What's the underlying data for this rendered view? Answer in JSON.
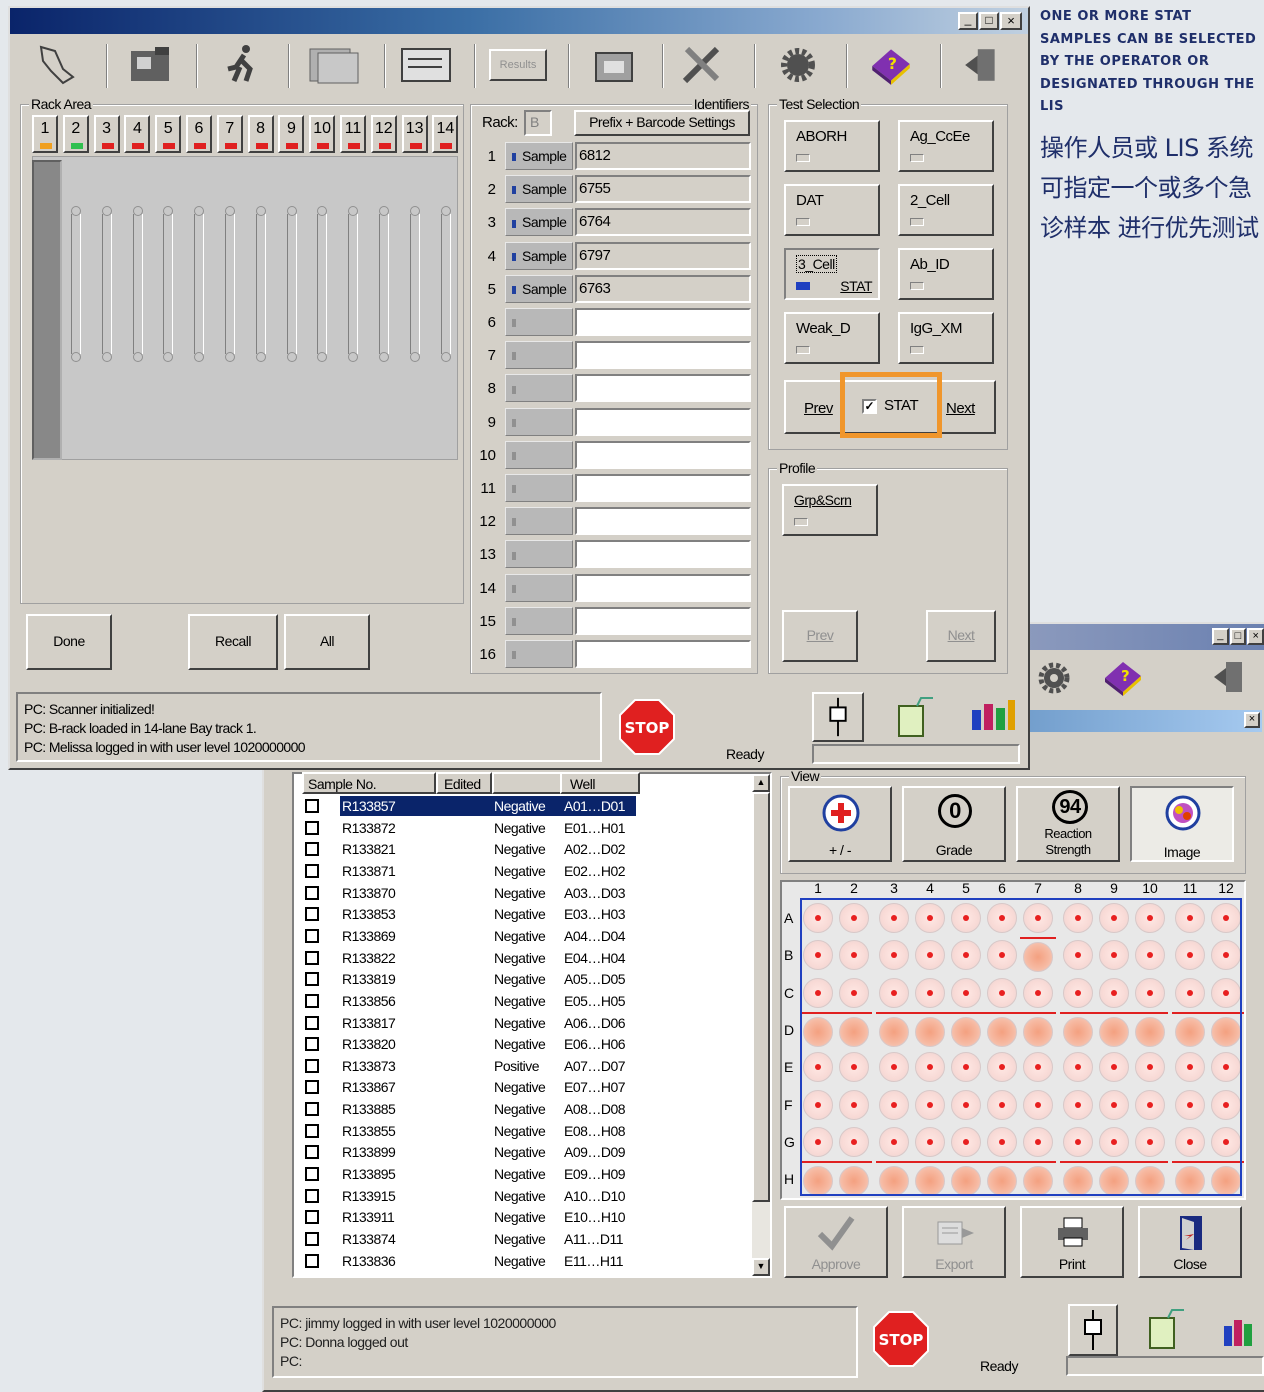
{
  "annotation": {
    "english": "ONE OR MORE STAT SAMPLES CAN BE SELECTED BY THE OPERATOR OR DESIGNATED THROUGH THE LIS",
    "chinese": "操作人员或 LIS 系统 可指定一个或多个急诊样本 进行优先测试"
  },
  "toolbar": {
    "icons": [
      "load-icon",
      "rack-icon",
      "run-icon",
      "results-stack-icon",
      "worklist-icon",
      "results-icon",
      "archive-icon",
      "tools-icon",
      "settings-gear-icon",
      "help-book-icon",
      "exit-icon"
    ],
    "results_label": "Results"
  },
  "rack_area": {
    "title": "Rack Area",
    "columns": [
      {
        "num": "1",
        "status": "#f0a020"
      },
      {
        "num": "2",
        "status": "#30c050"
      },
      {
        "num": "3",
        "status": "#e02020"
      },
      {
        "num": "4",
        "status": "#e02020"
      },
      {
        "num": "5",
        "status": "#e02020"
      },
      {
        "num": "6",
        "status": "#e02020"
      },
      {
        "num": "7",
        "status": "#e02020"
      },
      {
        "num": "8",
        "status": "#e02020"
      },
      {
        "num": "9",
        "status": "#e02020"
      },
      {
        "num": "10",
        "status": "#e02020"
      },
      {
        "num": "11",
        "status": "#e02020"
      },
      {
        "num": "12",
        "status": "#e02020"
      },
      {
        "num": "13",
        "status": "#e02020"
      },
      {
        "num": "14",
        "status": "#e02020"
      }
    ],
    "done": "Done",
    "recall": "Recall",
    "all": "All"
  },
  "identifiers": {
    "title": "Identifiers",
    "rack_label": "Rack:",
    "rack_value": "B",
    "prefix_button": "Prefix + Barcode Settings",
    "rows": [
      {
        "n": "1",
        "tag": "Sample",
        "value": "6812"
      },
      {
        "n": "2",
        "tag": "Sample",
        "value": "6755"
      },
      {
        "n": "3",
        "tag": "Sample",
        "value": "6764"
      },
      {
        "n": "4",
        "tag": "Sample",
        "value": "6797"
      },
      {
        "n": "5",
        "tag": "Sample",
        "value": "6763"
      },
      {
        "n": "6",
        "tag": "",
        "value": ""
      },
      {
        "n": "7",
        "tag": "",
        "value": ""
      },
      {
        "n": "8",
        "tag": "",
        "value": ""
      },
      {
        "n": "9",
        "tag": "",
        "value": ""
      },
      {
        "n": "10",
        "tag": "",
        "value": ""
      },
      {
        "n": "11",
        "tag": "",
        "value": ""
      },
      {
        "n": "12",
        "tag": "",
        "value": ""
      },
      {
        "n": "13",
        "tag": "",
        "value": ""
      },
      {
        "n": "14",
        "tag": "",
        "value": ""
      },
      {
        "n": "15",
        "tag": "",
        "value": ""
      },
      {
        "n": "16",
        "tag": "",
        "value": ""
      }
    ]
  },
  "test_selection": {
    "title": "Test Selection",
    "tests": [
      "ABORH",
      "Ag_CcEe",
      "DAT",
      "2_Cell",
      "3_Cell",
      "Ab_ID",
      "Weak_D",
      "IgG_XM"
    ],
    "stat_tag": "STAT",
    "prev": "Prev",
    "stat_checkbox": "STAT",
    "next": "Next"
  },
  "profile": {
    "title": "Profile",
    "button": "Grp&Scrn",
    "prev": "Prev",
    "next": "Next"
  },
  "status_front": {
    "lines": [
      "PC: Scanner initialized!",
      "PC: B-rack loaded in 14-lane Bay track 1.",
      "PC: Melissa logged in with user level 1020000000"
    ],
    "stop": "STOP",
    "ready": "Ready"
  },
  "results": {
    "headers": [
      "Sample No.",
      "Edited",
      "",
      "Well"
    ],
    "rows": [
      {
        "sample": "R133857",
        "result": "Negative",
        "well": "A01…D01"
      },
      {
        "sample": "R133872",
        "result": "Negative",
        "well": "E01…H01"
      },
      {
        "sample": "R133821",
        "result": "Negative",
        "well": "A02…D02"
      },
      {
        "sample": "R133871",
        "result": "Negative",
        "well": "E02…H02"
      },
      {
        "sample": "R133870",
        "result": "Negative",
        "well": "A03…D03"
      },
      {
        "sample": "R133853",
        "result": "Negative",
        "well": "E03…H03"
      },
      {
        "sample": "R133869",
        "result": "Negative",
        "well": "A04…D04"
      },
      {
        "sample": "R133822",
        "result": "Negative",
        "well": "E04…H04"
      },
      {
        "sample": "R133819",
        "result": "Negative",
        "well": "A05…D05"
      },
      {
        "sample": "R133856",
        "result": "Negative",
        "well": "E05…H05"
      },
      {
        "sample": "R133817",
        "result": "Negative",
        "well": "A06…D06"
      },
      {
        "sample": "R133820",
        "result": "Negative",
        "well": "E06…H06"
      },
      {
        "sample": "R133873",
        "result": "Positive",
        "well": "A07…D07"
      },
      {
        "sample": "R133867",
        "result": "Negative",
        "well": "E07…H07"
      },
      {
        "sample": "R133885",
        "result": "Negative",
        "well": "A08…D08"
      },
      {
        "sample": "R133855",
        "result": "Negative",
        "well": "E08…H08"
      },
      {
        "sample": "R133899",
        "result": "Negative",
        "well": "A09…D09"
      },
      {
        "sample": "R133895",
        "result": "Negative",
        "well": "E09…H09"
      },
      {
        "sample": "R133915",
        "result": "Negative",
        "well": "A10…D10"
      },
      {
        "sample": "R133911",
        "result": "Negative",
        "well": "E10…H10"
      },
      {
        "sample": "R133874",
        "result": "Negative",
        "well": "A11…D11"
      },
      {
        "sample": "R133836",
        "result": "Negative",
        "well": "E11…H11"
      }
    ],
    "view_title": "View",
    "view_buttons": {
      "plusminus": "+ / -",
      "grade_num": "0",
      "grade": "Grade",
      "strength_num": "94",
      "strength1": "Reaction",
      "strength2": "Strength",
      "image": "Image"
    },
    "plate_cols": [
      "1",
      "2",
      "3",
      "4",
      "5",
      "6",
      "7",
      "8",
      "9",
      "10",
      "11",
      "12"
    ],
    "plate_rows": [
      "A",
      "B",
      "C",
      "D",
      "E",
      "F",
      "G",
      "H"
    ],
    "actions": {
      "approve": "Approve",
      "export": "Export",
      "print": "Print",
      "close": "Close"
    }
  },
  "status_back": {
    "lines": [
      "PC: jimmy logged in with user level 1020000000",
      "PC: Donna logged out",
      "PC:"
    ],
    "stop": "STOP",
    "ready": "Ready"
  },
  "colors": {
    "highlight": "#f0962c",
    "selection": "#0a246a",
    "titlebar": "#0a246a"
  }
}
